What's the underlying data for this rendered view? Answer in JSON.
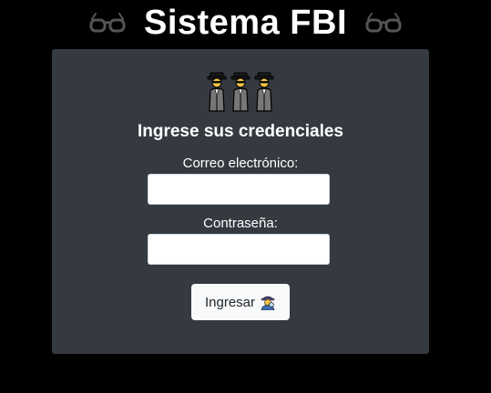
{
  "header": {
    "title": "Sistema FBI",
    "left_icon": "glasses-icon",
    "right_icon": "glasses-icon"
  },
  "login": {
    "decoration_icons": [
      "man-in-business-suit-icon",
      "man-in-business-suit-icon",
      "man-in-business-suit-icon"
    ],
    "heading": "Ingrese sus credenciales",
    "email_label": "Correo electrónico:",
    "email_value": "",
    "password_label": "Contraseña:",
    "password_value": "",
    "submit_label": "Ingresar",
    "submit_icon": "detective-icon"
  },
  "colors": {
    "page_background": "#000000",
    "card_background": "#343a40",
    "button_background": "#f8f9fa",
    "text": "#ffffff"
  }
}
